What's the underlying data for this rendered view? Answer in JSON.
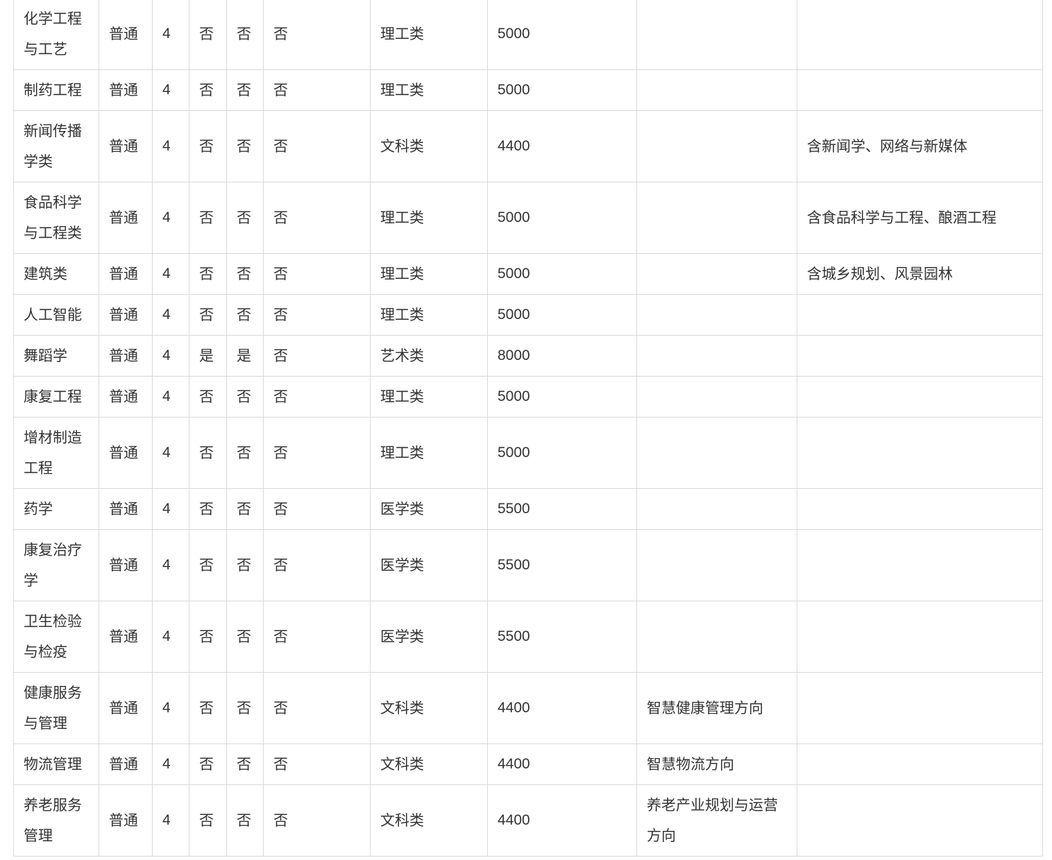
{
  "table": {
    "rows": [
      {
        "name": "化学工程与工艺",
        "type": "普通",
        "years": "4",
        "c1": "否",
        "c2": "否",
        "c3": "否",
        "category": "理工类",
        "fee": "5000",
        "direction": "",
        "note": "",
        "lines": 2
      },
      {
        "name": "制药工程",
        "type": "普通",
        "years": "4",
        "c1": "否",
        "c2": "否",
        "c3": "否",
        "category": "理工类",
        "fee": "5000",
        "direction": "",
        "note": "",
        "lines": 1
      },
      {
        "name": "新闻传播学类",
        "type": "普通",
        "years": "4",
        "c1": "否",
        "c2": "否",
        "c3": "否",
        "category": "文科类",
        "fee": "4400",
        "direction": "",
        "note": "含新闻学、网络与新媒体",
        "lines": 2
      },
      {
        "name": "食品科学与工程类",
        "type": "普通",
        "years": "4",
        "c1": "否",
        "c2": "否",
        "c3": "否",
        "category": "理工类",
        "fee": "5000",
        "direction": "",
        "note": "含食品科学与工程、酿酒工程",
        "lines": 2
      },
      {
        "name": "建筑类",
        "type": "普通",
        "years": "4",
        "c1": "否",
        "c2": "否",
        "c3": "否",
        "category": "理工类",
        "fee": "5000",
        "direction": "",
        "note": "含城乡规划、风景园林",
        "lines": 1
      },
      {
        "name": "人工智能",
        "type": "普通",
        "years": "4",
        "c1": "否",
        "c2": "否",
        "c3": "否",
        "category": "理工类",
        "fee": "5000",
        "direction": "",
        "note": "",
        "lines": 1
      },
      {
        "name": "舞蹈学",
        "type": "普通",
        "years": "4",
        "c1": "是",
        "c2": "是",
        "c3": "否",
        "category": "艺术类",
        "fee": "8000",
        "direction": "",
        "note": "",
        "lines": 1
      },
      {
        "name": "康复工程",
        "type": "普通",
        "years": "4",
        "c1": "否",
        "c2": "否",
        "c3": "否",
        "category": "理工类",
        "fee": "5000",
        "direction": "",
        "note": "",
        "lines": 1
      },
      {
        "name": "增材制造工程",
        "type": "普通",
        "years": "4",
        "c1": "否",
        "c2": "否",
        "c3": "否",
        "category": "理工类",
        "fee": "5000",
        "direction": "",
        "note": "",
        "lines": 2
      },
      {
        "name": "药学",
        "type": "普通",
        "years": "4",
        "c1": "否",
        "c2": "否",
        "c3": "否",
        "category": "医学类",
        "fee": "5500",
        "direction": "",
        "note": "",
        "lines": 1
      },
      {
        "name": "康复治疗学",
        "type": "普通",
        "years": "4",
        "c1": "否",
        "c2": "否",
        "c3": "否",
        "category": "医学类",
        "fee": "5500",
        "direction": "",
        "note": "",
        "lines": 2
      },
      {
        "name": "卫生检验与检疫",
        "type": "普通",
        "years": "4",
        "c1": "否",
        "c2": "否",
        "c3": "否",
        "category": "医学类",
        "fee": "5500",
        "direction": "",
        "note": "",
        "lines": 2
      },
      {
        "name": "健康服务与管理",
        "type": "普通",
        "years": "4",
        "c1": "否",
        "c2": "否",
        "c3": "否",
        "category": "文科类",
        "fee": "4400",
        "direction": "智慧健康管理方向",
        "note": "",
        "lines": 2
      },
      {
        "name": "物流管理",
        "type": "普通",
        "years": "4",
        "c1": "否",
        "c2": "否",
        "c3": "否",
        "category": "文科类",
        "fee": "4400",
        "direction": "智慧物流方向",
        "note": "",
        "lines": 1
      },
      {
        "name": "养老服务管理",
        "type": "普通",
        "years": "4",
        "c1": "否",
        "c2": "否",
        "c3": "否",
        "category": "文科类",
        "fee": "4400",
        "direction": "养老产业规划与运营方向",
        "note": "",
        "lines": 2
      }
    ]
  }
}
